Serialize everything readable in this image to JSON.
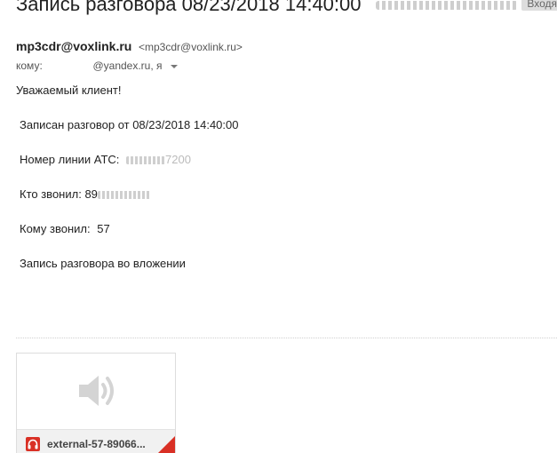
{
  "subject": {
    "title": "Запись разговора 08/23/2018 14:40:00",
    "label": "Входя"
  },
  "sender": {
    "name": "mp3cdr@voxlink.ru",
    "address": "<mp3cdr@voxlink.ru>"
  },
  "recipient": {
    "prefix": "кому:",
    "domain": "@yandex.ru, я"
  },
  "body": {
    "greeting": "Уважаемый клиент!",
    "recorded": "Записан разговор от 08/23/2018 14:40:00",
    "line_label": "Номер линии АТС:",
    "line_partial": "7200",
    "caller_label": "Кто звонил:",
    "caller_partial": "89",
    "callee_label": "Кому звонил:",
    "callee_value": "57",
    "attachment_note": "Запись разговора во вложении"
  },
  "attachment": {
    "file_name": "external-57-89066...",
    "icon": "audio-speaker-icon",
    "badge_icon": "headphones-icon",
    "accent_color": "#d93025"
  }
}
